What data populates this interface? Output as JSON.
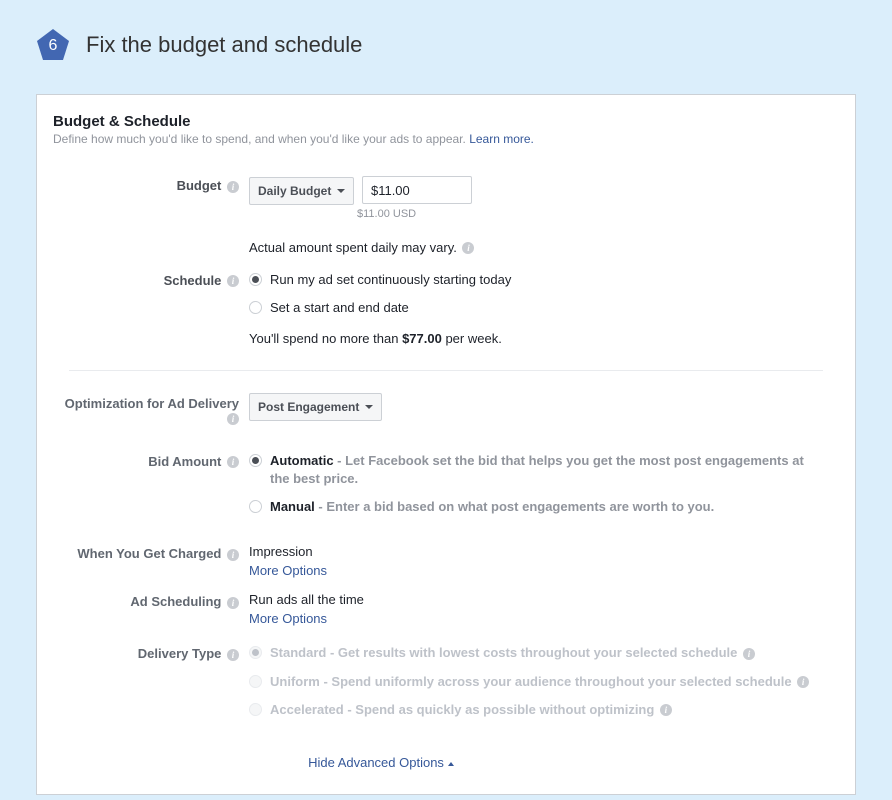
{
  "step": {
    "number": "6",
    "title": "Fix the budget and schedule"
  },
  "panel": {
    "title": "Budget & Schedule",
    "description": "Define how much you'd like to spend, and when you'd like your ads to appear. ",
    "learn_more": "Learn more."
  },
  "budget": {
    "label": "Budget",
    "dropdown": "Daily Budget",
    "value": "$11.00",
    "sub_note": "$11.00 USD",
    "vary_note": "Actual amount spent daily may vary."
  },
  "schedule": {
    "label": "Schedule",
    "opt1": "Run my ad set continuously starting today",
    "opt2": "Set a start and end date",
    "spend_prefix": "You'll spend no more than ",
    "spend_amount": "$77.00",
    "spend_suffix": " per week."
  },
  "optimization": {
    "label": "Optimization for Ad Delivery",
    "dropdown": "Post Engagement"
  },
  "bid": {
    "label": "Bid Amount",
    "auto_bold": "Automatic",
    "auto_text": " - Let Facebook set the bid that helps you get the most post engagements at the best price.",
    "manual_bold": "Manual",
    "manual_text": " - Enter a bid based on what post engagements are worth to you."
  },
  "charged": {
    "label": "When You Get Charged",
    "value": "Impression",
    "more": "More Options"
  },
  "ad_sched": {
    "label": "Ad Scheduling",
    "value": "Run ads all the time",
    "more": "More Options"
  },
  "delivery": {
    "label": "Delivery Type",
    "std_bold": "Standard",
    "std_text": " - Get results with lowest costs throughout your selected schedule",
    "uni_bold": "Uniform",
    "uni_text": " - Spend uniformly across your audience throughout your selected schedule",
    "acc_bold": "Accelerated",
    "acc_text": " - Spend as quickly as possible without optimizing"
  },
  "hide_advanced": "Hide Advanced Options"
}
